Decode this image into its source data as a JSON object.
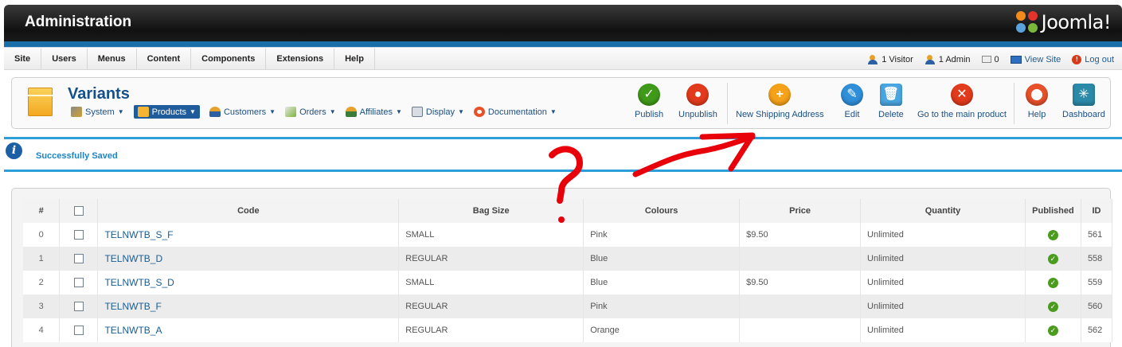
{
  "header": {
    "title": "Administration",
    "logo_text": "Joomla!"
  },
  "menu": {
    "items": [
      "Site",
      "Users",
      "Menus",
      "Content",
      "Components",
      "Extensions",
      "Help"
    ]
  },
  "status": {
    "visitors": "1 Visitor",
    "admins": "1 Admin",
    "messages": "0",
    "view_site": "View Site",
    "logout": "Log out"
  },
  "page": {
    "title": "Variants"
  },
  "submenu": {
    "items": [
      {
        "label": "System",
        "icon": "wrench-icon"
      },
      {
        "label": "Products",
        "icon": "box-icon",
        "active": true
      },
      {
        "label": "Customers",
        "icon": "users-icon"
      },
      {
        "label": "Orders",
        "icon": "orders-icon"
      },
      {
        "label": "Affiliates",
        "icon": "affiliates-icon"
      },
      {
        "label": "Display",
        "icon": "display-icon"
      },
      {
        "label": "Documentation",
        "icon": "lifebuoy-icon"
      }
    ]
  },
  "toolbar": {
    "publish": "Publish",
    "unpublish": "Unpublish",
    "new_shipping": "New Shipping Address",
    "edit": "Edit",
    "delete": "Delete",
    "main_product": "Go to the main product",
    "help": "Help",
    "dashboard": "Dashboard"
  },
  "message": {
    "text": "Successfully Saved"
  },
  "table": {
    "headers": [
      "#",
      "Code",
      "Bag Size",
      "Colours",
      "Price",
      "Quantity",
      "Published",
      "ID"
    ],
    "rows": [
      {
        "num": "0",
        "code": "TELNWTB_S_F",
        "bag": "SMALL",
        "colour": "Pink",
        "price": "$9.50",
        "qty": "Unlimited",
        "id": "561"
      },
      {
        "num": "1",
        "code": "TELNWTB_D",
        "bag": "REGULAR",
        "colour": "Blue",
        "price": "",
        "qty": "Unlimited",
        "id": "558"
      },
      {
        "num": "2",
        "code": "TELNWTB_S_D",
        "bag": "SMALL",
        "colour": "Blue",
        "price": "$9.50",
        "qty": "Unlimited",
        "id": "559"
      },
      {
        "num": "3",
        "code": "TELNWTB_F",
        "bag": "REGULAR",
        "colour": "Pink",
        "price": "",
        "qty": "Unlimited",
        "id": "560"
      },
      {
        "num": "4",
        "code": "TELNWTB_A",
        "bag": "REGULAR",
        "colour": "Orange",
        "price": "",
        "qty": "Unlimited",
        "id": "562"
      }
    ]
  },
  "colors": {
    "brand_blue": "#1b6fa8",
    "link": "#1b5c92",
    "annotation": "#e8000b"
  }
}
